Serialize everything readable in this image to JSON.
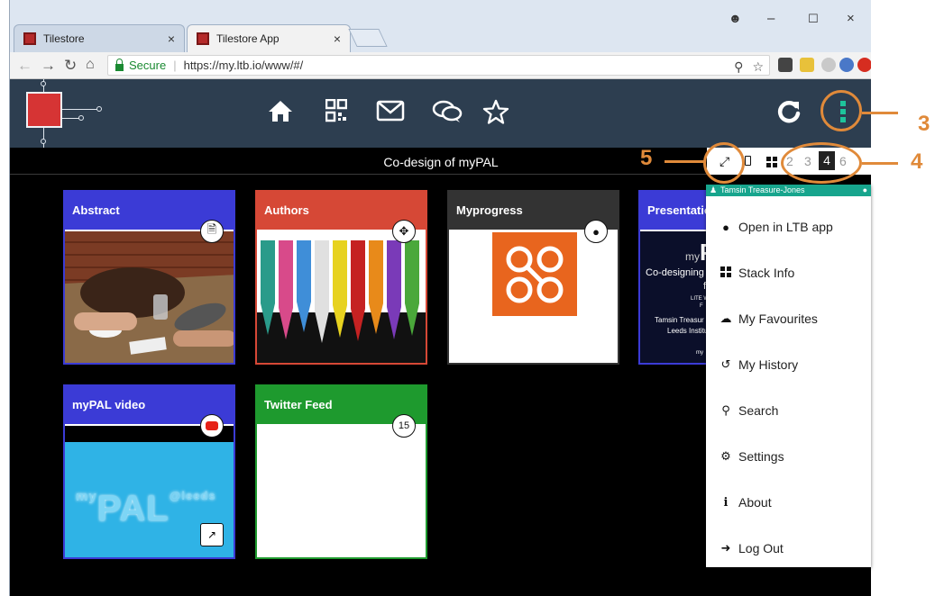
{
  "browser": {
    "tabs": [
      {
        "label": "Tilestore"
      },
      {
        "label": "Tilestore App"
      }
    ],
    "close_glyph": "×",
    "url": {
      "secure_label": "Secure",
      "text": "https://my.ltb.io/www/#/"
    },
    "nav_icons": [
      "back-icon",
      "forward-icon",
      "reload-icon",
      "home-icon"
    ]
  },
  "app": {
    "stack_title": "Co-design of myPAL",
    "header_icons": [
      "home-icon",
      "qr-code-icon",
      "mail-icon",
      "chat-icon",
      "star-icon",
      "refresh-icon",
      "kebab-menu-icon"
    ],
    "toolbar": {
      "pages": [
        "2",
        "3",
        "4",
        "6"
      ],
      "active_page": "4"
    },
    "tiles": [
      {
        "title": "Abstract",
        "color": "#3b3bd6",
        "badge": "document-icon"
      },
      {
        "title": "Authors",
        "color": "#d64836",
        "badge": "move-icon"
      },
      {
        "title": "Myprogress",
        "color": "#333333",
        "badge": "android-icon"
      },
      {
        "title": "Presentatio",
        "color": "#3b3bd6"
      },
      {
        "title": "myPAL video",
        "color": "#3b3bd6",
        "badge": "youtube-icon",
        "image_text": "myPAL @leeds"
      },
      {
        "title": "Twitter Feed",
        "color": "#1e9a2e",
        "badge": "15"
      }
    ],
    "presentation_preview": {
      "lines": [
        "Co-designing",
        "f",
        "LITE W",
        "F",
        "Tamsin Treasur",
        "Leeds Institu",
        "my"
      ]
    },
    "menu": {
      "user": "Tamsin Treasure-Jones",
      "items": [
        {
          "label": "Open in LTB app",
          "icon": "android-icon"
        },
        {
          "label": "Stack Info",
          "icon": "grid-icon"
        },
        {
          "label": "My Favourites",
          "icon": "cloud-icon"
        },
        {
          "label": "My History",
          "icon": "history-icon"
        },
        {
          "label": "Search",
          "icon": "search-icon"
        },
        {
          "label": "Settings",
          "icon": "gear-icon"
        },
        {
          "label": "About",
          "icon": "info-icon"
        },
        {
          "label": "Log Out",
          "icon": "logout-icon"
        }
      ]
    }
  },
  "annotations": {
    "callout_3": "3",
    "callout_4": "4",
    "callout_5": "5",
    "color": "#e08a3a"
  }
}
